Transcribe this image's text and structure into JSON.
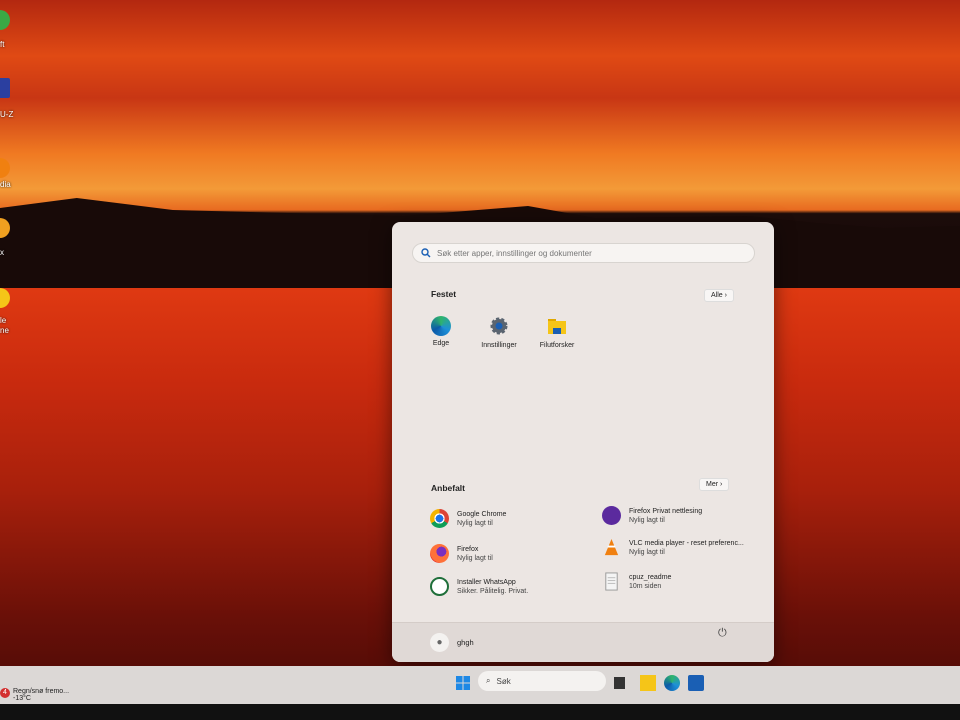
{
  "desktop": {
    "icons": [
      {
        "label": "ft",
        "color": "#3aa845"
      },
      {
        "label": "U-Z",
        "color": "#2b3fa0"
      },
      {
        "label": "dia",
        "color": "#f08010"
      },
      {
        "label": "x",
        "color": "#f0a020"
      },
      {
        "label": "le\nne",
        "color": "#f5c518"
      }
    ]
  },
  "start_menu": {
    "search": {
      "placeholder": "Søk etter apper, innstillinger og dokumenter",
      "icon": "search-icon"
    },
    "pinned": {
      "title": "Festet",
      "all_label": "Alle",
      "items": [
        {
          "label": "Edge",
          "icon": "edge-icon"
        },
        {
          "label": "Innstillinger",
          "icon": "settings-gear-icon"
        },
        {
          "label": "Filutforsker",
          "icon": "folder-icon"
        }
      ]
    },
    "recommended": {
      "title": "Anbefalt",
      "more_label": "Mer",
      "items": [
        {
          "title": "Google Chrome",
          "subtitle": "Nylig lagt til",
          "icon": "chrome-icon"
        },
        {
          "title": "Firefox",
          "subtitle": "Nylig lagt til",
          "icon": "firefox-icon"
        },
        {
          "title": "Installer WhatsApp",
          "subtitle": "Sikker. Pålitelig. Privat.",
          "icon": "whatsapp-icon"
        },
        {
          "title": "Firefox Privat nettlesing",
          "subtitle": "Nylig lagt til",
          "icon": "firefox-private-icon"
        },
        {
          "title": "VLC media player - reset preferenc...",
          "subtitle": "Nylig lagt til",
          "icon": "vlc-icon"
        },
        {
          "title": "cpuz_readme",
          "subtitle": "10m siden",
          "icon": "document-icon"
        }
      ]
    },
    "user": {
      "name": "ghgh"
    }
  },
  "taskbar": {
    "search_label": "Søk",
    "weather": {
      "text": "Regn/snø fremo...",
      "temp": "-13°C",
      "badge": "4"
    }
  }
}
